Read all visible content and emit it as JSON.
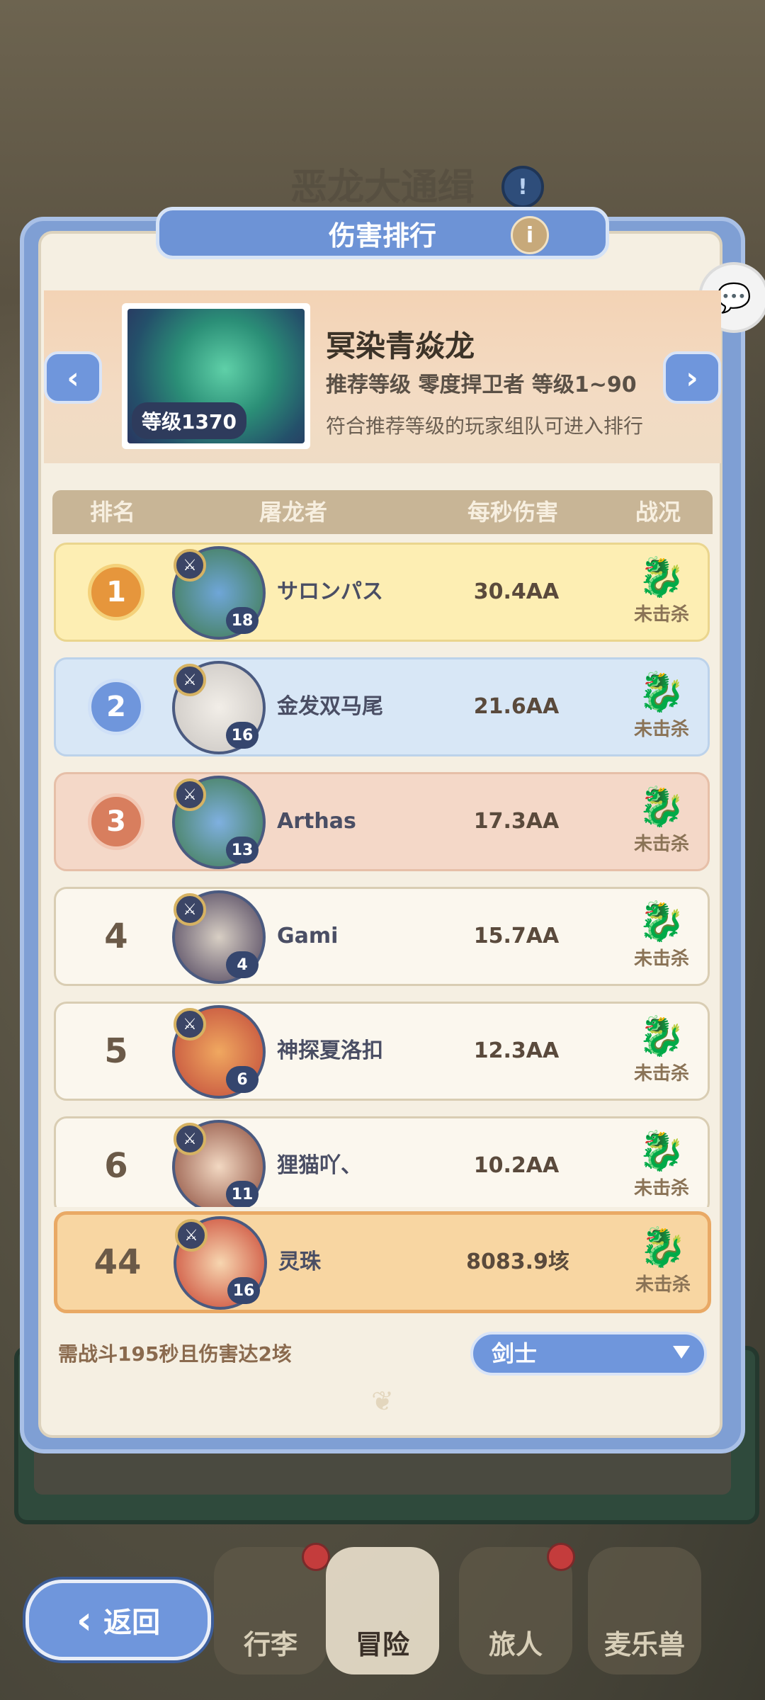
{
  "background": {
    "faint_title": "恶龙大通缉",
    "info_icon": "info-icon"
  },
  "panel": {
    "title": "伤害排行",
    "info_icon": "info-icon"
  },
  "boss": {
    "name": "冥染青焱龙",
    "level_badge": "等级1370",
    "recommend": "推荐等级 零度捍卫者 等级1~90",
    "note": "符合推荐等级的玩家组队可进入排行"
  },
  "table": {
    "headers": [
      "排名",
      "屠龙者",
      "每秒伤害",
      "战况"
    ],
    "rows": [
      {
        "rank": "1",
        "name": "サロンパス",
        "level": "18",
        "damage": "30.4AA",
        "status": "未击杀"
      },
      {
        "rank": "2",
        "name": "金发双马尾",
        "level": "16",
        "damage": "21.6AA",
        "status": "未击杀"
      },
      {
        "rank": "3",
        "name": "Arthas",
        "level": "13",
        "damage": "17.3AA",
        "status": "未击杀"
      },
      {
        "rank": "4",
        "name": "Gami",
        "level": "4",
        "damage": "15.7AA",
        "status": "未击杀"
      },
      {
        "rank": "5",
        "name": "神探夏洛扣",
        "level": "6",
        "damage": "12.3AA",
        "status": "未击杀"
      },
      {
        "rank": "6",
        "name": "狸猫吖、",
        "level": "11",
        "damage": "10.2AA",
        "status": "未击杀"
      }
    ]
  },
  "me": {
    "rank": "44",
    "name": "灵珠",
    "level": "16",
    "damage": "8083.9垓",
    "status": "未击杀"
  },
  "footer": {
    "requirement": "需战斗195秒且伤害达2垓",
    "class_selected": "剑士"
  },
  "nav": {
    "back": "返回",
    "items": [
      "行李",
      "冒险",
      "旅人",
      "麦乐兽"
    ]
  },
  "colors": {
    "accent_blue": "#6f96dc",
    "gold": "#e6963c",
    "silver": "#6f96dc",
    "bronze": "#d87e5e"
  }
}
